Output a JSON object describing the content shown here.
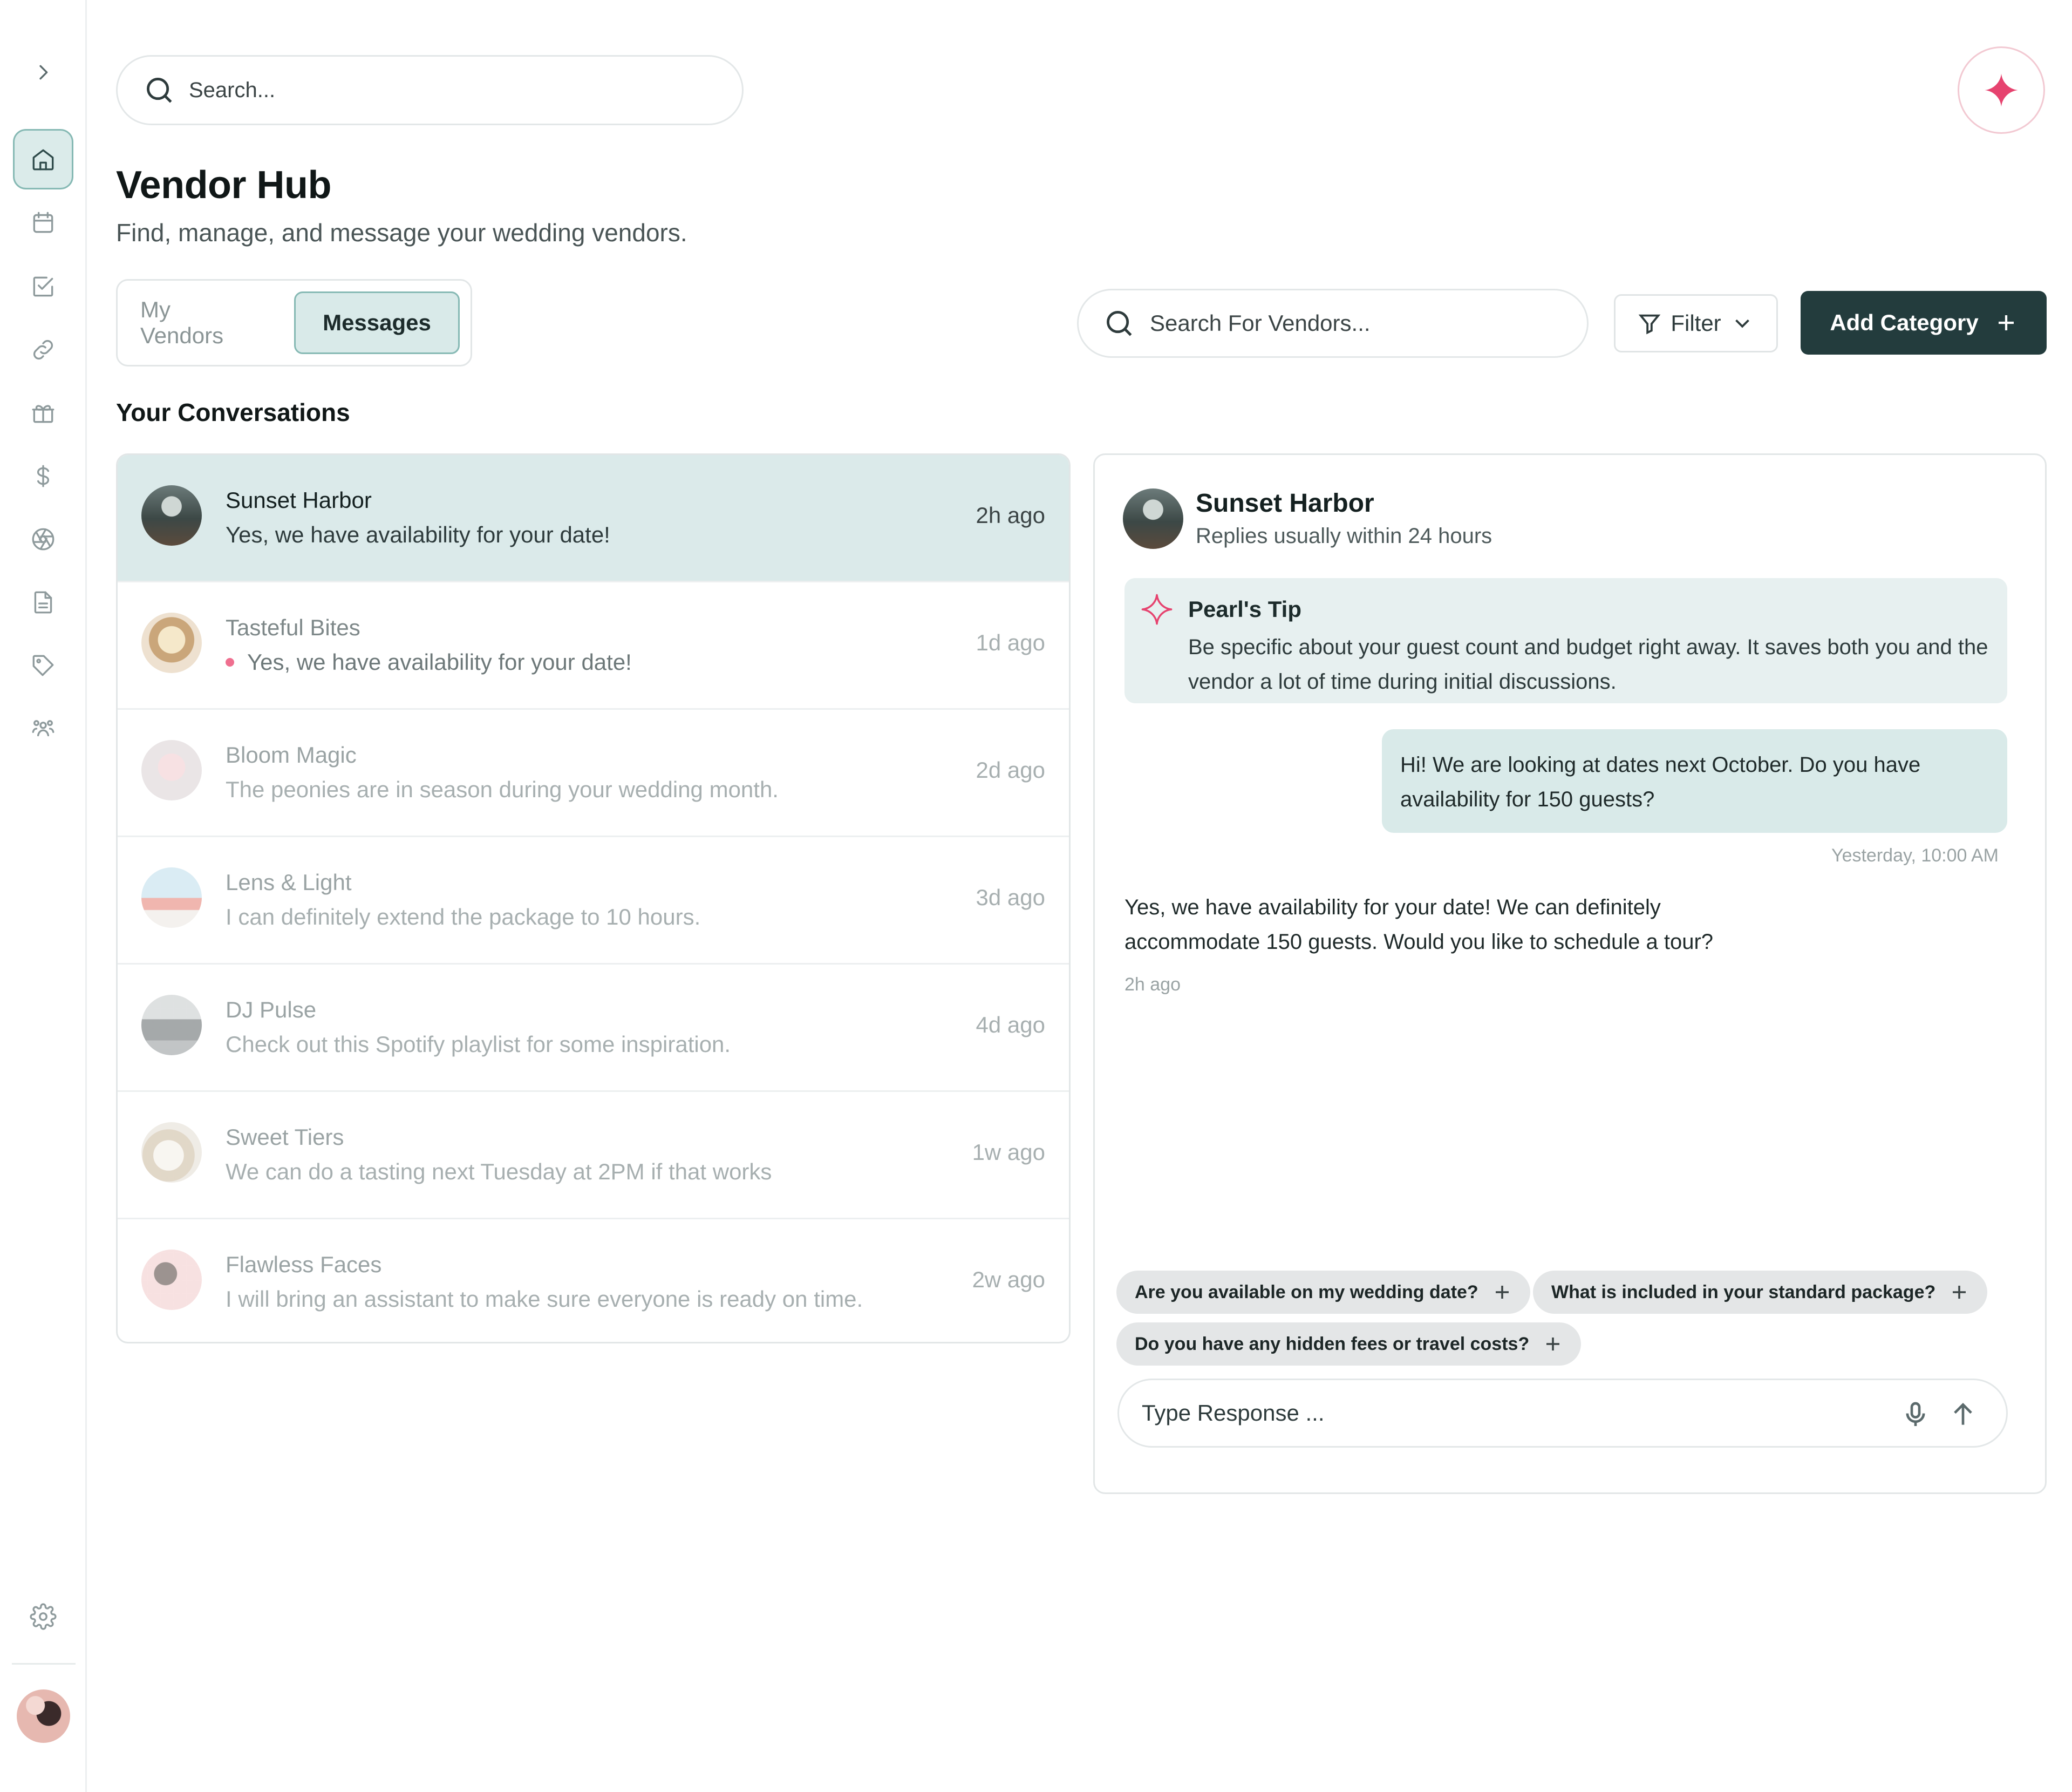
{
  "colors": {
    "accent": "#233c3d",
    "selected_bg": "#dbeaea",
    "tip_bg": "#e7f0f0",
    "ai_pink": "#e6436f",
    "unread_dot": "#ef6f8f"
  },
  "sidebar": {
    "icons": [
      "chevron-right-icon",
      "home-icon",
      "calendar-icon",
      "checklist-icon",
      "link-icon",
      "gift-icon",
      "dollar-icon",
      "aperture-icon",
      "document-icon",
      "tag-icon",
      "people-icon",
      "gear-icon"
    ],
    "active": "home-icon"
  },
  "top_search": {
    "placeholder": "Search..."
  },
  "header": {
    "title": "Vendor Hub",
    "subtitle": "Find, manage, and message your wedding vendors."
  },
  "tabs": [
    {
      "label": "My Vendors",
      "active": false
    },
    {
      "label": "Messages",
      "active": true
    }
  ],
  "vendor_search": {
    "placeholder": "Search For Vendors..."
  },
  "filter": {
    "label": "Filter"
  },
  "add_category": {
    "label": "Add Category"
  },
  "conversations": {
    "title": "Your Conversations",
    "items": [
      {
        "name": "Sunset Harbor",
        "message": "Yes, we have availability for your date!",
        "time": "2h ago",
        "selected": true,
        "unread": false
      },
      {
        "name": "Tasteful Bites",
        "message": "Yes, we have availability for your date!",
        "time": "1d ago",
        "selected": false,
        "unread": true
      },
      {
        "name": "Bloom Magic",
        "message": "The peonies are in season during your wedding month.",
        "time": "2d ago",
        "selected": false,
        "unread": false
      },
      {
        "name": "Lens & Light",
        "message": "I can definitely extend the package to 10 hours.",
        "time": "3d ago",
        "selected": false,
        "unread": false
      },
      {
        "name": "DJ Pulse",
        "message": "Check out this Spotify playlist for some inspiration.",
        "time": "4d ago",
        "selected": false,
        "unread": false
      },
      {
        "name": "Sweet Tiers",
        "message": "We can do a tasting next Tuesday at 2PM if that works",
        "time": "1w ago",
        "selected": false,
        "unread": false
      },
      {
        "name": "Flawless Faces",
        "message": "I will bring an assistant to make sure everyone is ready on time.",
        "time": "2w ago",
        "selected": false,
        "unread": false
      }
    ]
  },
  "chat": {
    "name": "Sunset Harbor",
    "reply_time": "Replies usually within 24 hours",
    "tip": {
      "title": "Pearl's Tip",
      "text": "Be specific about your guest count and budget right away. It saves both you and the vendor a lot of time during initial discussions."
    },
    "outgoing": {
      "text": "Hi! We are looking at dates next October. Do you have availability for 150 guests?",
      "time": "Yesterday, 10:00 AM"
    },
    "incoming": {
      "text": "Yes, we have availability for your date! We can definitely accommodate 150 guests. Would you like to schedule a tour?",
      "time": "2h ago"
    },
    "suggestions": [
      "Are you available on my wedding date?",
      "What is included in your standard package?",
      "Do you have any hidden fees or travel costs?"
    ],
    "composer": {
      "placeholder": "Type Response ..."
    }
  }
}
